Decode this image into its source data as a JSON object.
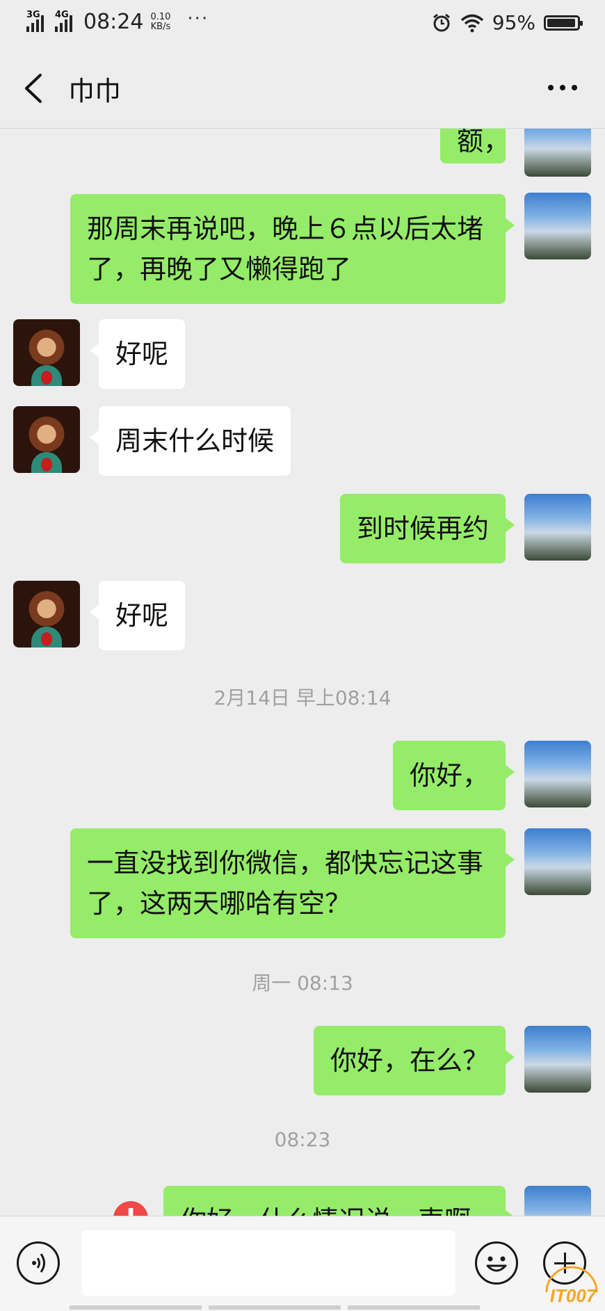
{
  "status_bar": {
    "signal_1": "3G",
    "signal_2": "4G",
    "time": "08:24",
    "speed_value": "0.10",
    "speed_unit": "KB/s",
    "more": "···",
    "battery_percent": "95%",
    "battery_level": 0.95,
    "icons": [
      "alarm-icon",
      "wifi-icon",
      "battery-icon"
    ]
  },
  "header": {
    "title": "巾巾",
    "back_icon": "chevron-left-icon",
    "more_icon": "more-dots-icon"
  },
  "messages": [
    {
      "from": "me",
      "text": "额，"
    },
    {
      "from": "me",
      "text": "那周末再说吧，晚上６点以后太堵了，再晚了又懒得跑了"
    },
    {
      "from": "them",
      "text": "好呢"
    },
    {
      "from": "them",
      "text": "周末什么时候"
    },
    {
      "from": "me",
      "text": "到时候再约"
    },
    {
      "from": "them",
      "text": "好呢"
    },
    {
      "type": "time",
      "text": "2月14日 早上08:14"
    },
    {
      "from": "me",
      "text": "你好，"
    },
    {
      "from": "me",
      "text": "一直没找到你微信，都快忘记这事了，这两天哪哈有空？"
    },
    {
      "type": "time",
      "text": "周一 08:13"
    },
    {
      "from": "me",
      "text": "你好，在么？"
    },
    {
      "type": "time",
      "text": "08:23"
    },
    {
      "from": "me",
      "text": "你好，什么情况说一声啊",
      "status": "failed",
      "status_icon": "!"
    }
  ],
  "input_bar": {
    "voice_icon": "voice-icon",
    "input_value": "",
    "emoji_icon": "emoji-icon",
    "plus_icon": "plus-icon"
  },
  "watermark": "IT007",
  "colors": {
    "background": "#ededed",
    "my_bubble": "#95ec69",
    "their_bubble": "#ffffff",
    "timestamp": "#a0a0a0",
    "error": "#f04848",
    "watermark": "#f5a623"
  }
}
